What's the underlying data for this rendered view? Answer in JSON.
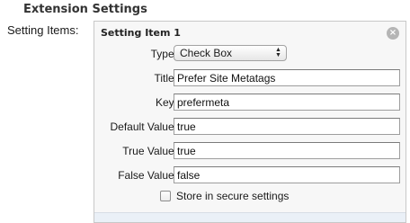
{
  "section_title": "Extension Settings",
  "field_label": "Setting Items:",
  "panel": {
    "title": "Setting Item 1",
    "close_glyph": "⊗",
    "type_label": "Type:",
    "type_value": "Check Box",
    "rows": [
      {
        "label": "Title:",
        "value": "Prefer Site Metatags"
      },
      {
        "label": "Key:",
        "value": "prefermeta"
      },
      {
        "label": "Default Value:",
        "value": "true"
      },
      {
        "label": "True Value:",
        "value": "true"
      },
      {
        "label": "False Value:",
        "value": "false"
      }
    ],
    "secure_checkbox": {
      "label": "Store in secure settings",
      "checked": false
    }
  }
}
